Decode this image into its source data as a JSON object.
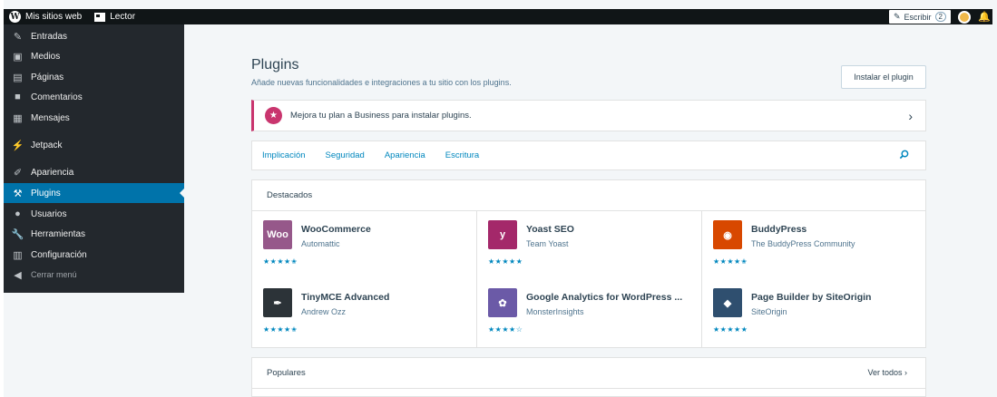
{
  "masterbar": {
    "my_sites": "Mis sitios web",
    "reader": "Lector",
    "write": "Escribir",
    "write_count": "2"
  },
  "sidebar": {
    "items": [
      {
        "label": "Entradas",
        "icon": "pin-icon"
      },
      {
        "label": "Medios",
        "icon": "media-icon"
      },
      {
        "label": "Páginas",
        "icon": "pages-icon"
      },
      {
        "label": "Comentarios",
        "icon": "comments-icon"
      },
      {
        "label": "Mensajes",
        "icon": "messages-icon"
      },
      {
        "label": "Jetpack",
        "icon": "jetpack-icon"
      },
      {
        "label": "Apariencia",
        "icon": "appearance-icon"
      },
      {
        "label": "Plugins",
        "icon": "plugins-icon"
      },
      {
        "label": "Usuarios",
        "icon": "users-icon"
      },
      {
        "label": "Herramientas",
        "icon": "tools-icon"
      },
      {
        "label": "Configuración",
        "icon": "settings-icon"
      },
      {
        "label": "Cerrar menú",
        "icon": "collapse-icon"
      }
    ]
  },
  "main": {
    "title": "Plugins",
    "subtitle": "Añade nuevas funcionalidades e integraciones a tu sitio con los plugins.",
    "install_button": "Instalar el plugin",
    "upsell": "Mejora tu plan a Business para instalar plugins.",
    "tabs": [
      "Implicación",
      "Seguridad",
      "Apariencia",
      "Escritura"
    ],
    "featured_title": "Destacados",
    "featured": [
      {
        "name": "WooCommerce",
        "author": "Automattic",
        "rating": 4.5,
        "color": "#96588a",
        "logo": "woo"
      },
      {
        "name": "Yoast SEO",
        "author": "Team Yoast",
        "rating": 5,
        "color": "#a4286a",
        "logo": "y"
      },
      {
        "name": "BuddyPress",
        "author": "The BuddyPress Community",
        "rating": 4.5,
        "color": "#d84800",
        "logo": "bp"
      },
      {
        "name": "TinyMCE Advanced",
        "author": "Andrew Ozz",
        "rating": 4.5,
        "color": "#2c3338",
        "logo": "tm"
      },
      {
        "name": "Google Analytics for WordPress ...",
        "author": "MonsterInsights",
        "rating": 4,
        "color": "#6b5aa7",
        "logo": "mi"
      },
      {
        "name": "Page Builder by SiteOrigin",
        "author": "SiteOrigin",
        "rating": 5,
        "color": "#2f4f6f",
        "logo": "so"
      }
    ],
    "popular_title": "Populares",
    "see_all": "Ver todos"
  }
}
